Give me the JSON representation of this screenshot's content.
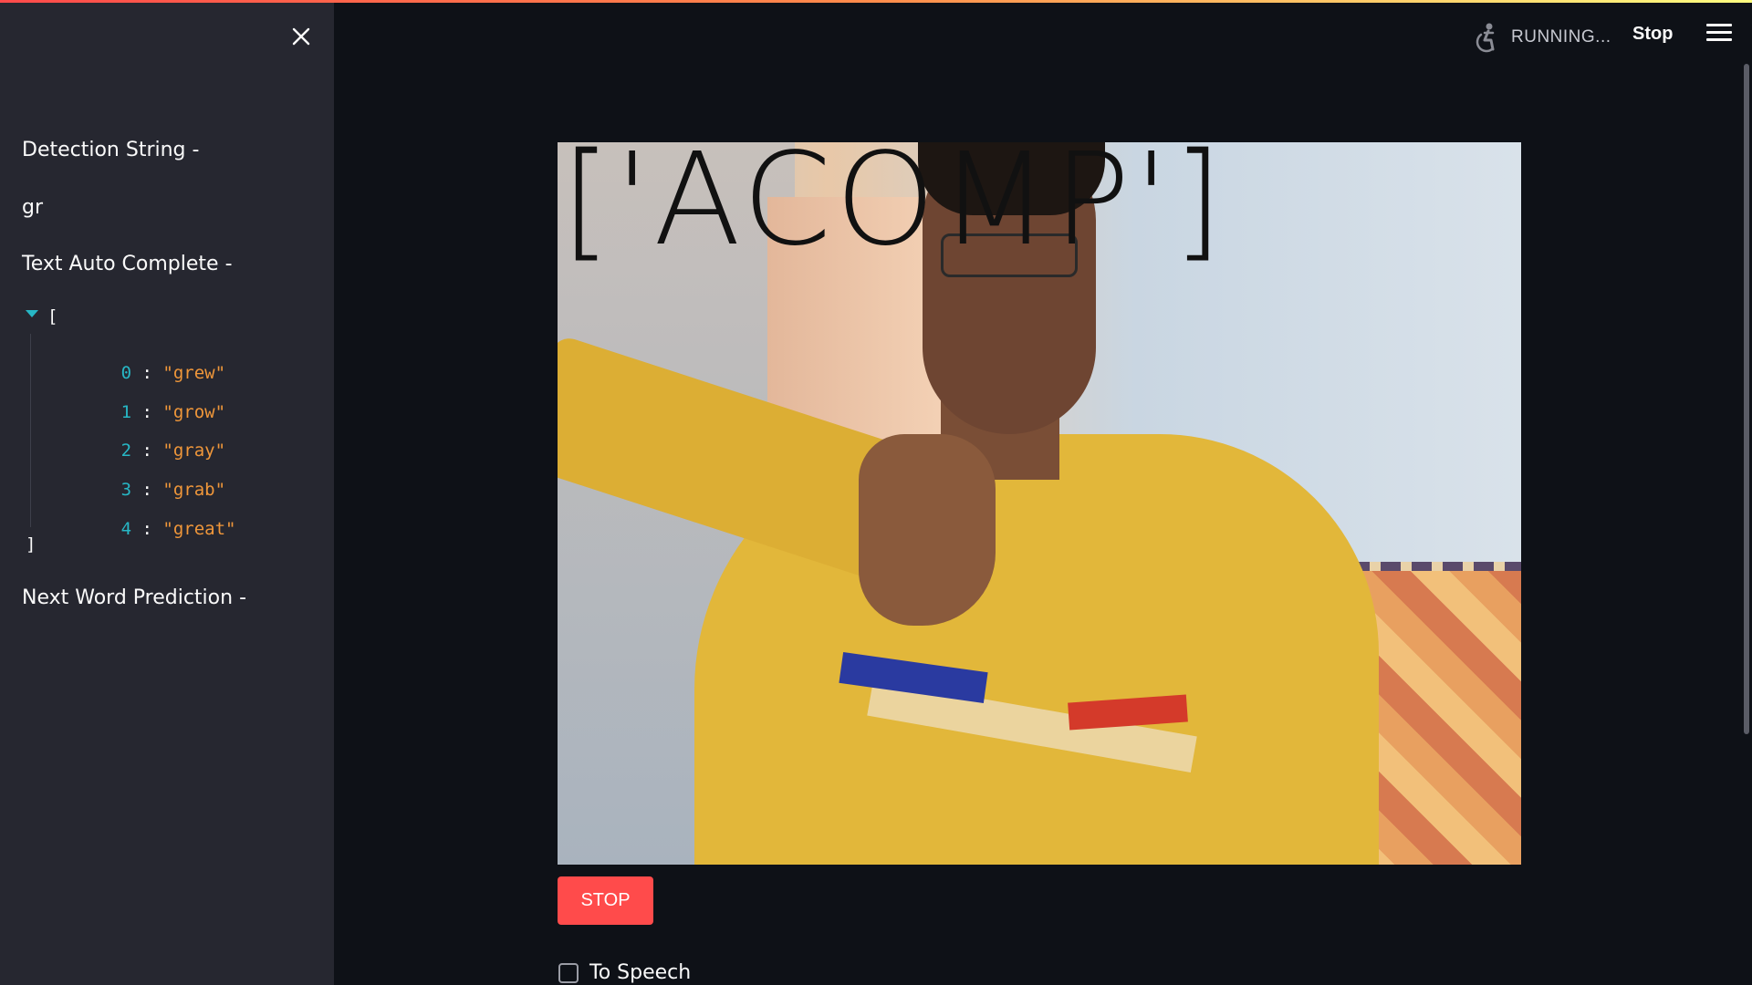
{
  "sidebar": {
    "detection_label": "Detection String -",
    "detection_value": "gr",
    "autocomplete_label": "Text Auto Complete -",
    "autocomplete_open": "[",
    "autocomplete_close": "]",
    "suggestions": [
      {
        "index": "0",
        "value": "\"grew\""
      },
      {
        "index": "1",
        "value": "\"grow\""
      },
      {
        "index": "2",
        "value": "\"gray\""
      },
      {
        "index": "3",
        "value": "\"grab\""
      },
      {
        "index": "4",
        "value": "\"great\""
      }
    ],
    "next_word_label": "Next Word Prediction -"
  },
  "header": {
    "status": "RUNNING...",
    "stop_label": "Stop",
    "status_icon": "running-figure-icon",
    "menu_icon": "hamburger-menu-icon"
  },
  "main": {
    "video_overlay_text": "['ACOMP']",
    "stop_button_label": "STOP",
    "to_speech_label": "To Speech",
    "to_speech_checked": false
  },
  "colors": {
    "accent": "#ff4b4b",
    "sidebar_bg": "#262730",
    "main_bg": "#0e1117",
    "json_index": "#27b7c5",
    "json_string": "#f0973a"
  }
}
